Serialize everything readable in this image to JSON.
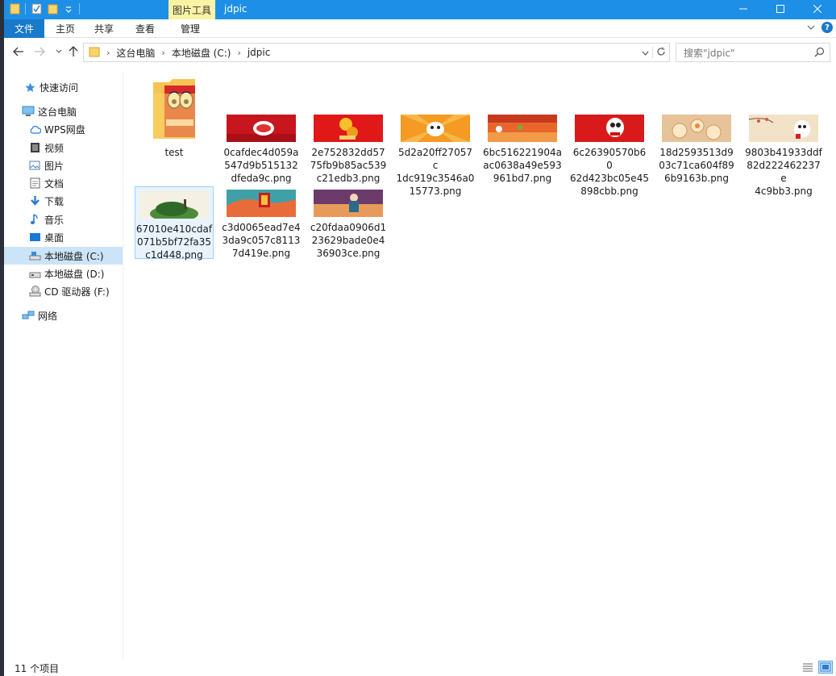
{
  "titlebar": {
    "context_tab": "图片工具",
    "title": "jdpic",
    "controls": [
      "minimize",
      "maximize",
      "close"
    ],
    "accent": "#1e8fe6"
  },
  "ribbon": {
    "tabs": [
      {
        "label": "文件"
      },
      {
        "label": "主页"
      },
      {
        "label": "共享"
      },
      {
        "label": "查看"
      },
      {
        "label": "管理"
      }
    ]
  },
  "address": {
    "crumbs": [
      "这台电脑",
      "本地磁盘 (C:)",
      "jdpic"
    ],
    "search_placeholder": "搜索\"jdpic\""
  },
  "sidebar": {
    "items": [
      {
        "label": "快速访问",
        "icon": "star-icon"
      },
      {
        "label": "这台电脑",
        "icon": "computer-icon"
      },
      {
        "label": "WPS网盘",
        "icon": "cloud-icon"
      },
      {
        "label": "视频",
        "icon": "video-icon"
      },
      {
        "label": "图片",
        "icon": "picture-icon"
      },
      {
        "label": "文档",
        "icon": "document-icon"
      },
      {
        "label": "下载",
        "icon": "download-icon"
      },
      {
        "label": "音乐",
        "icon": "music-icon"
      },
      {
        "label": "桌面",
        "icon": "desktop-icon"
      },
      {
        "label": "本地磁盘 (C:)",
        "icon": "drive-icon"
      },
      {
        "label": "本地磁盘 (D:)",
        "icon": "drive-icon"
      },
      {
        "label": "CD 驱动器 (F:)",
        "icon": "cd-drive-icon"
      },
      {
        "label": "网络",
        "icon": "network-icon"
      }
    ]
  },
  "files": [
    {
      "name": "test",
      "type": "folder"
    },
    {
      "name": "0cafdec4d059a547d9b515132dfeda9c.png",
      "lines": [
        "0cafdec4d059a",
        "547d9b515132",
        "dfeda9c.png"
      ]
    },
    {
      "name": "2e752832dd5775fb9b85ac539c21edb3.png",
      "lines": [
        "2e752832dd57",
        "75fb9b85ac539",
        "c21edb3.png"
      ]
    },
    {
      "name": "5d2a20ff27057c1dc919c3546a015773.png",
      "lines": [
        "5d2a20ff27057c",
        "1dc919c3546a0",
        "15773.png"
      ]
    },
    {
      "name": "6bc516221904aac0638a49e593961bd7.png",
      "lines": [
        "6bc516221904a",
        "ac0638a49e593",
        "961bd7.png"
      ]
    },
    {
      "name": "6c26390570b6062d423bc05e45898cbb.png",
      "lines": [
        "6c26390570b60",
        "62d423bc05e45",
        "898cbb.png"
      ]
    },
    {
      "name": "18d2593513d903c71ca604f896b9163b.png",
      "lines": [
        "18d2593513d9",
        "03c71ca604f89",
        "6b9163b.png"
      ]
    },
    {
      "name": "9803b41933ddf82d222462237e4c9bb3.png",
      "lines": [
        "9803b41933ddf",
        "82d222462237e",
        "4c9bb3.png"
      ]
    },
    {
      "name": "67010e410cdaf071b5bf72fa35c1d448.png",
      "lines": [
        "67010e410cdaf",
        "071b5bf72fa35",
        "c1d448.png"
      ]
    },
    {
      "name": "c3d0065ead7e43da9c057c81137d419e.png",
      "lines": [
        "c3d0065ead7e4",
        "3da9c057c8113",
        "7d419e.png"
      ]
    },
    {
      "name": "c20fdaa0906d123629bade0e436903ce.png",
      "lines": [
        "c20fdaa0906d1",
        "23629bade0e4",
        "36903ce.png"
      ]
    }
  ],
  "status": {
    "count_text": "11 个项目"
  }
}
